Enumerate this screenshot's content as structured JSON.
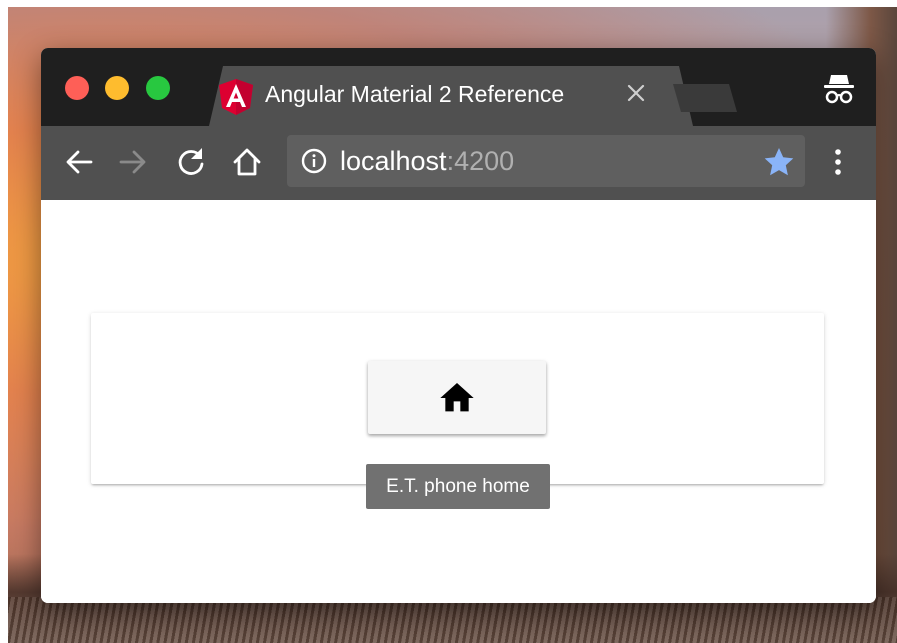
{
  "browser": {
    "tab": {
      "title": "Angular Material 2 Reference",
      "favicon": "angular-icon",
      "close_icon": "close-icon"
    },
    "address_bar": {
      "host": "localhost",
      "port": ":4200",
      "info_icon": "info-icon",
      "bookmark_icon": "star-icon"
    },
    "toolbar_icons": [
      "back-arrow-icon",
      "forward-arrow-icon",
      "reload-icon",
      "home-icon",
      "more-vertical-icon"
    ],
    "profile_icon": "incognito-icon"
  },
  "page": {
    "button": {
      "icon": "home-icon"
    },
    "tooltip": "E.T. phone home"
  },
  "colors": {
    "tab_bg": "#505050",
    "tabstrip_bg": "#1f1f1f",
    "angular_red": "#dd0031",
    "star_blue": "#8ab4f8",
    "tooltip_bg": "#717171"
  }
}
